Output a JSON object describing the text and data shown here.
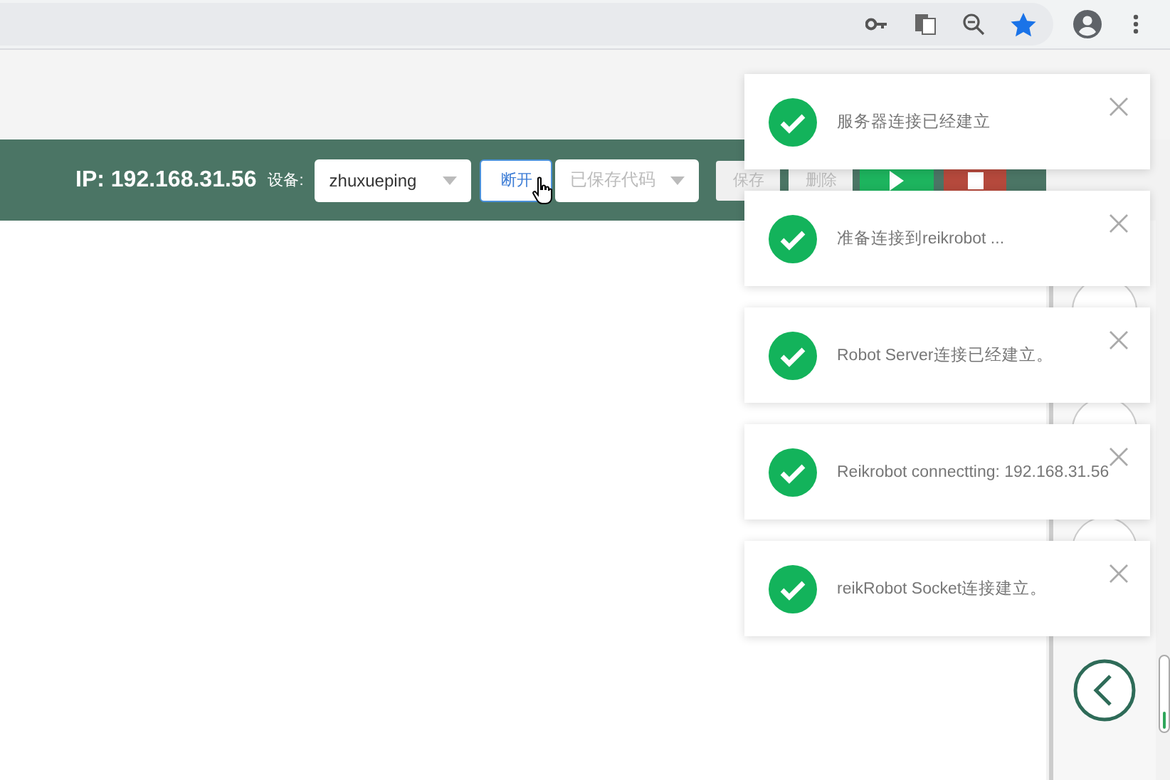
{
  "header": {
    "ip_label": "IP: 192.168.31.56",
    "device_label": "设备:",
    "device_select": {
      "value": "zhuxueping"
    },
    "disconnect_button": "断开",
    "code_select": {
      "placeholder": "已保存代码"
    },
    "save_button": "保存",
    "delete_button": "删除"
  },
  "notifications": [
    {
      "message": "服务器连接已经建立"
    },
    {
      "message": "准备连接到reikrobot ..."
    },
    {
      "message": "Robot Server连接已经建立。"
    },
    {
      "message": "Reikrobot connectting: 192.168.31.56"
    },
    {
      "message": "reikRobot Socket连接建立。"
    }
  ]
}
